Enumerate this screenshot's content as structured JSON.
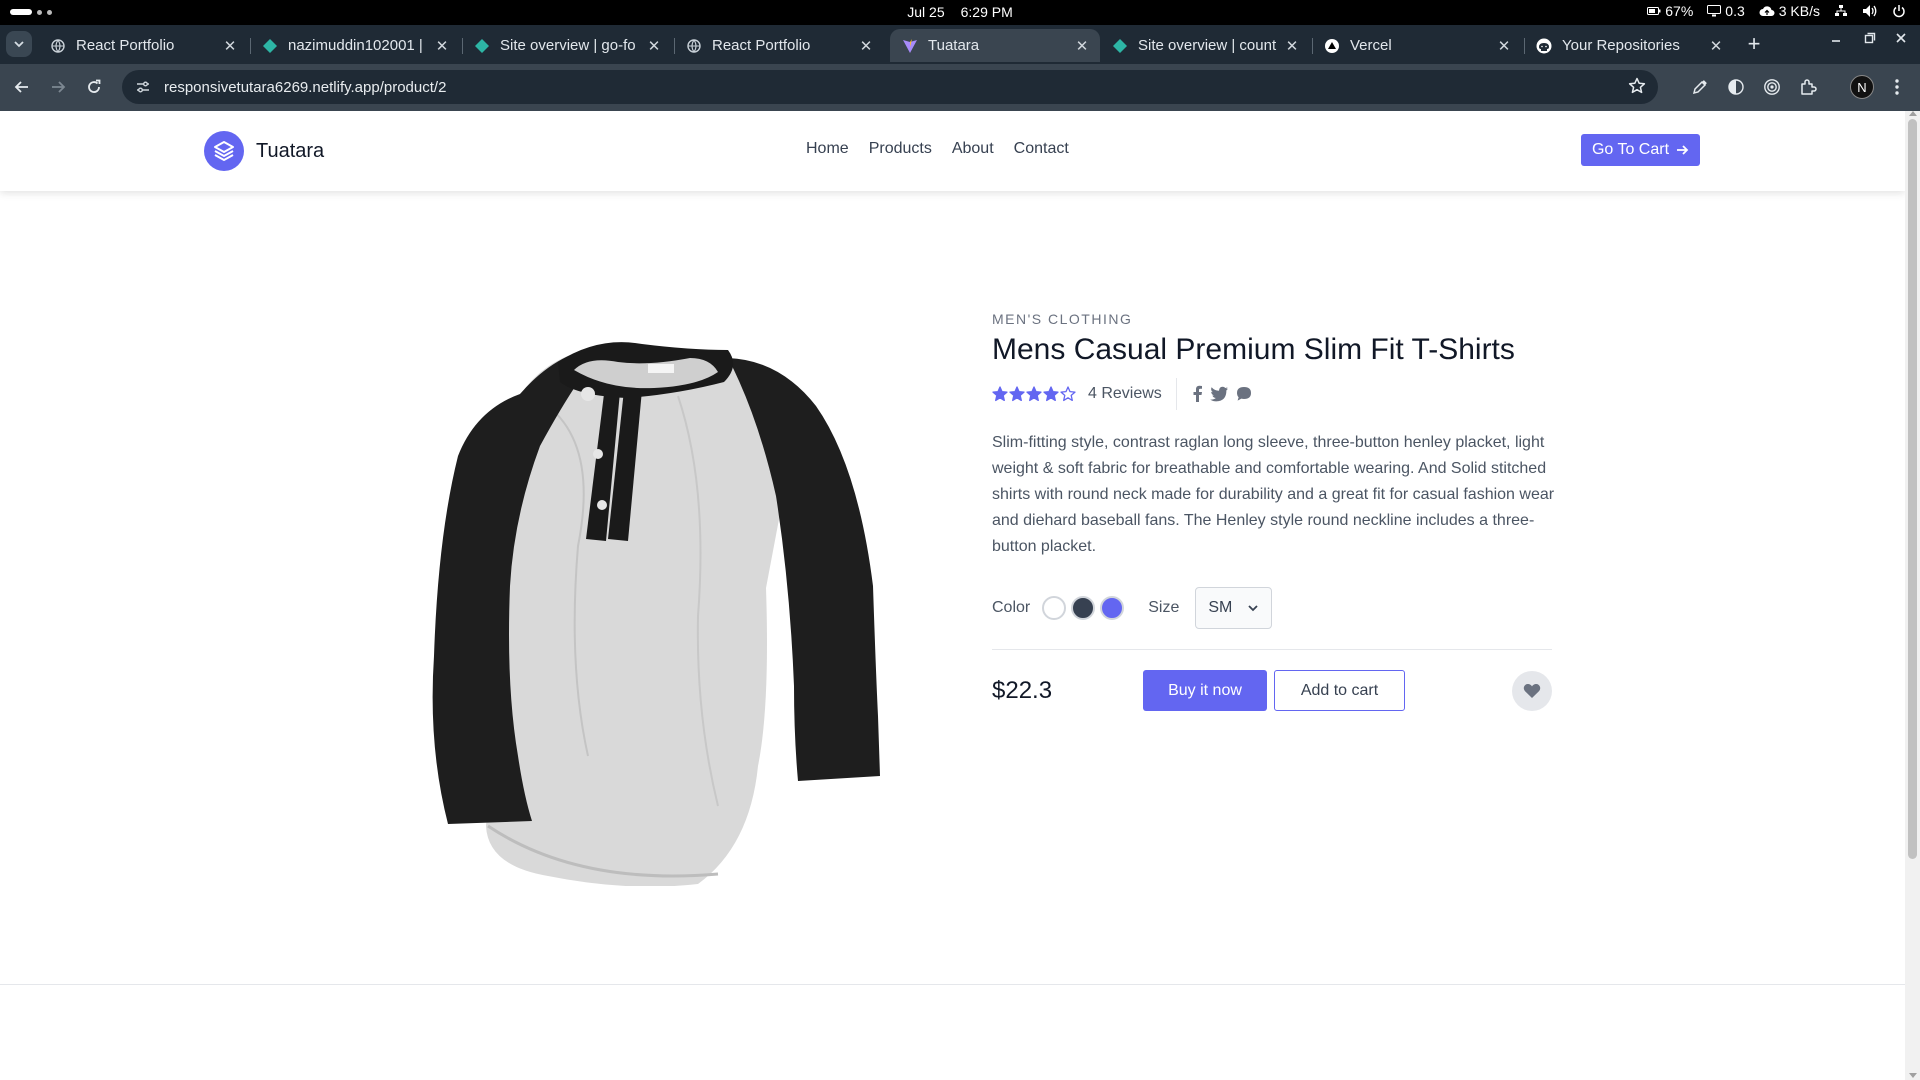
{
  "os": {
    "date": "Jul 25",
    "time": "6:29 PM",
    "battery": "67%",
    "cpu": "0.3",
    "network": "3 KB/s"
  },
  "browser": {
    "tabs": [
      {
        "title": "React Portfolio",
        "icon": "globe-icon"
      },
      {
        "title": "nazimuddin102001 |",
        "icon": "netlify-icon"
      },
      {
        "title": "Site overview | go-fo",
        "icon": "netlify-icon"
      },
      {
        "title": "React Portfolio",
        "icon": "globe-icon"
      },
      {
        "title": "Tuatara",
        "icon": "vite-icon"
      },
      {
        "title": "Site overview | count",
        "icon": "netlify-icon"
      },
      {
        "title": "Vercel",
        "icon": "vercel-icon"
      },
      {
        "title": "Your Repositories",
        "icon": "github-icon"
      }
    ],
    "active_tab_index": 4,
    "new_tab": "+",
    "url": "responsivetutara6269.netlify.app/product/2",
    "profile_initial": "N"
  },
  "site": {
    "brand": "Tuatara",
    "nav": [
      "Home",
      "Products",
      "About",
      "Contact"
    ],
    "cart_button": "Go To Cart",
    "accent_color": "#6366f1"
  },
  "product": {
    "category": "MEN'S CLOTHING",
    "title": "Mens Casual Premium Slim Fit T-Shirts",
    "rating": 4,
    "rating_max": 5,
    "reviews": "4 Reviews",
    "social": [
      "facebook-icon",
      "twitter-icon",
      "chat-icon"
    ],
    "description": "Slim-fitting style, contrast raglan long sleeve, three-button henley placket, light weight & soft fabric for breathable and comfortable wearing. And Solid stitched shirts with round neck made for durability and a great fit for casual fashion wear and diehard baseball fans. The Henley style round neckline includes a three-button placket.",
    "color_label": "Color",
    "colors": [
      "#ffffff",
      "#374151",
      "#6366f1"
    ],
    "size_label": "Size",
    "size_value": "SM",
    "price": "$22.3",
    "buy_label": "Buy it now",
    "add_to_cart_label": "Add to cart"
  }
}
